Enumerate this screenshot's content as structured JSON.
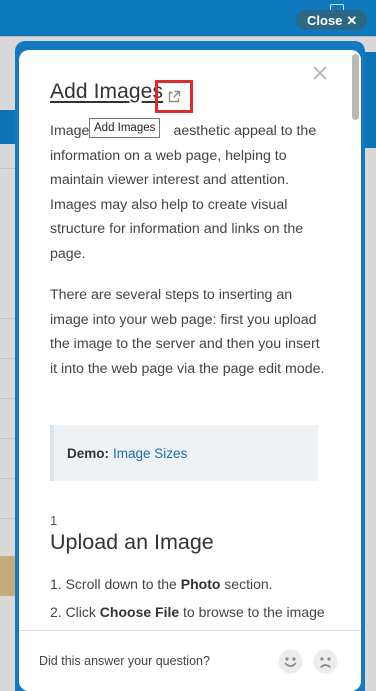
{
  "background": {
    "close_label": "Close",
    "close_icon": "x-icon"
  },
  "article": {
    "title": "Add Images",
    "external_link_icon": "external-link-icon",
    "tooltip": "Add Images",
    "intro_paragraph": "Images add visual aesthetic appeal to the information on a web page, helping to maintain viewer interest and attention. Images may also help to create visual structure for information and links on the page.",
    "intro_visible_before_tooltip": "Image",
    "intro_visible_after_tooltip": "aesthetic appeal to the information on a web page, helping to maintain viewer interest and attention. Images may also help to create visual structure for information and links on the page.",
    "steps_paragraph": "There are several steps to inserting an image into your web page: first you upload the image to the server and then you insert it into the web page via the page edit mode.",
    "demo": {
      "label": "Demo:",
      "link": "Image Sizes"
    },
    "step_number": "1",
    "step_title": "Upload an Image",
    "step_items": [
      {
        "prefix": "1. Scroll down to the ",
        "bold": "Photo",
        "suffix": " section."
      },
      {
        "prefix": "2. Click ",
        "bold": "Choose File",
        "suffix": " to browse to the image"
      }
    ]
  },
  "feedback": {
    "question": "Did this answer your question?",
    "positive_icon": "happy-face-icon",
    "negative_icon": "sad-face-icon"
  },
  "colors": {
    "panel_blue": "#1479c2",
    "highlight_red": "#dd2a2a",
    "link_blue": "#1a6fae"
  }
}
